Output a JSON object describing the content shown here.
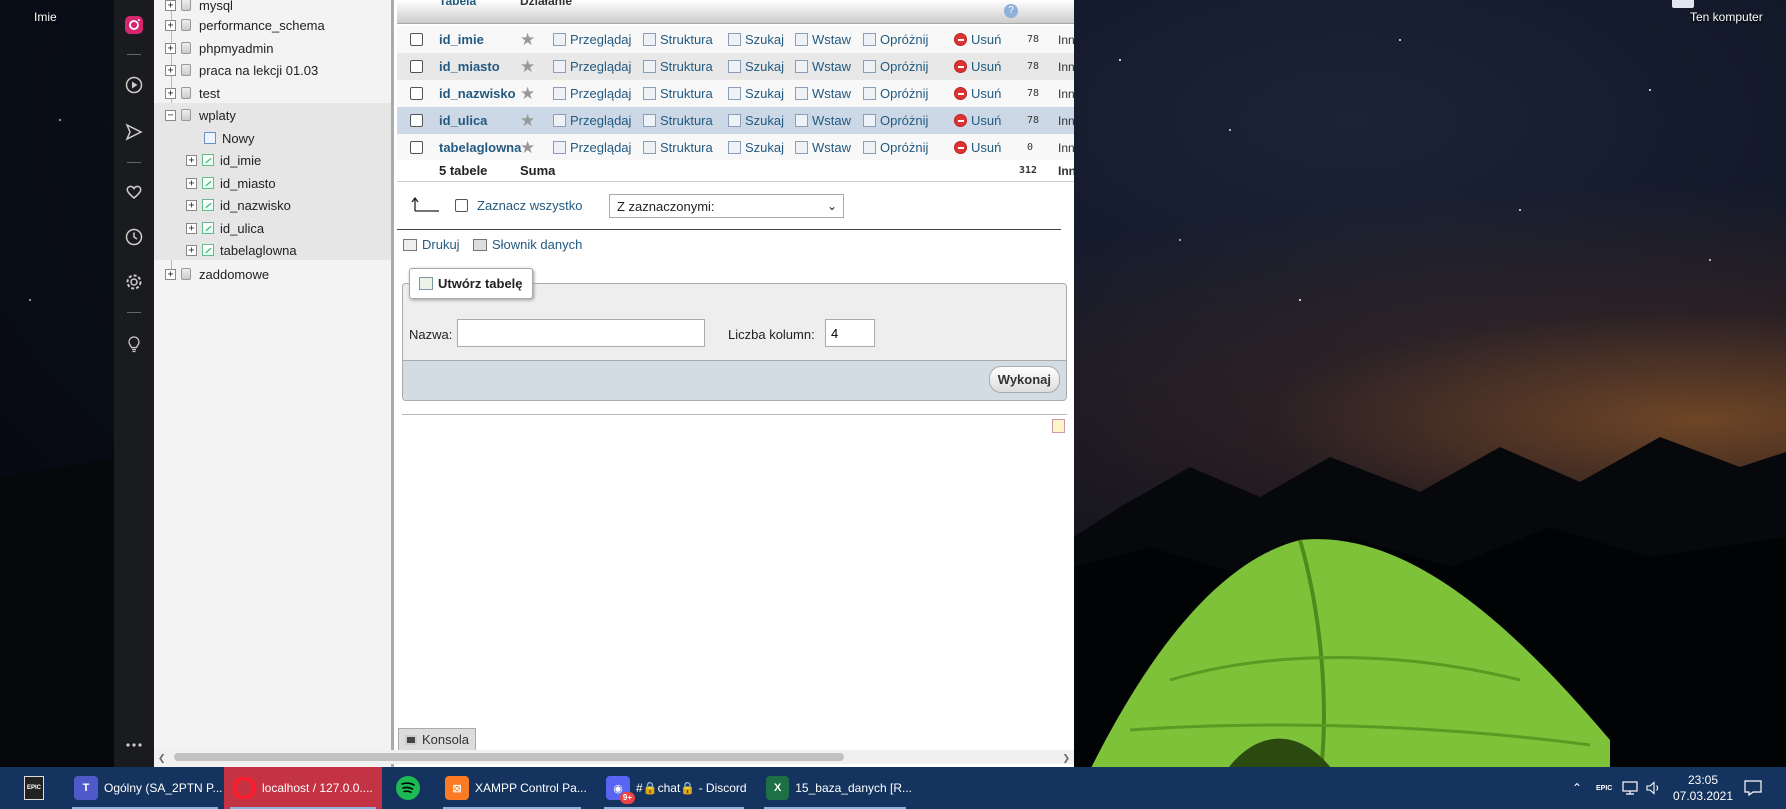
{
  "desktop": {
    "icon_left_label": "Imie",
    "icon_right_label": "Ten komputer"
  },
  "nav_tree": {
    "databases": [
      {
        "name": "mysql",
        "expanded": false
      },
      {
        "name": "performance_schema",
        "expanded": false
      },
      {
        "name": "phpmyadmin",
        "expanded": false
      },
      {
        "name": "praca na lekcji 01.03",
        "expanded": false
      },
      {
        "name": "test",
        "expanded": false
      },
      {
        "name": "wplaty",
        "expanded": true
      },
      {
        "name": "zaddomowe",
        "expanded": false
      }
    ],
    "new_label": "Nowy",
    "tables": [
      "id_imie",
      "id_miasto",
      "id_nazwisko",
      "id_ulica",
      "tabelaglowna"
    ]
  },
  "table_list": {
    "header": {
      "table": "Tabela",
      "action": "Działanie"
    },
    "actions": [
      "Przeglądaj",
      "Struktura",
      "Szukaj",
      "Wstaw",
      "Opróżnij",
      "Usuń"
    ],
    "rows": [
      {
        "name": "id_imie",
        "count": "78",
        "engine": "Inn"
      },
      {
        "name": "id_miasto",
        "count": "78",
        "engine": "Inn"
      },
      {
        "name": "id_nazwisko",
        "count": "78",
        "engine": "Inn"
      },
      {
        "name": "id_ulica",
        "count": "78",
        "engine": "Inn"
      },
      {
        "name": "tabelaglowna",
        "count": "0",
        "engine": "Inn"
      }
    ],
    "summary": {
      "label": "5 tabele",
      "sum_label": "Suma",
      "total": "312",
      "engine": "Inn"
    }
  },
  "bulk": {
    "select_all": "Zaznacz wszystko",
    "with_selected": "Z zaznaczonymi:"
  },
  "links": {
    "print": "Drukuj",
    "dictionary": "Słownik danych"
  },
  "create_table": {
    "legend": "Utwórz tabelę",
    "name_label": "Nazwa:",
    "name_value": "",
    "columns_label": "Liczba kolumn:",
    "columns_value": "4",
    "submit": "Wykonaj"
  },
  "console": {
    "label": "Konsola"
  },
  "taskbar": {
    "items": [
      {
        "label": "Ogólny (SA_2PTN P..."
      },
      {
        "label": "localhost / 127.0.0...."
      },
      {
        "label": "XAMPP Control Pa..."
      },
      {
        "label": "#🔒chat🔒 - Discord"
      },
      {
        "label": "15_baza_danych  [R..."
      }
    ],
    "discord_badge": "9+",
    "time": "23:05",
    "date": "07.03.2021"
  }
}
